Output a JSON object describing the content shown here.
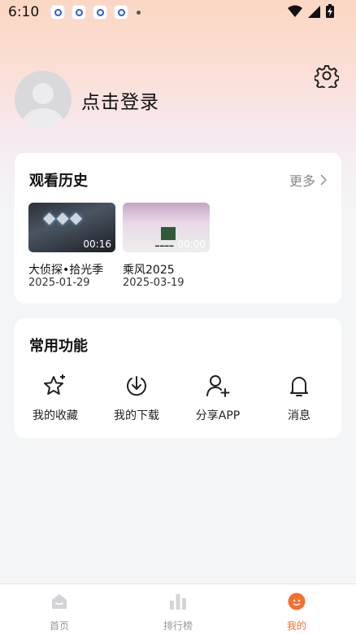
{
  "status_bar": {
    "time": "6:10"
  },
  "profile": {
    "login_text": "点击登录"
  },
  "history": {
    "title": "观看历史",
    "more_label": "更多",
    "items": [
      {
        "name": "大侦探•拾光季",
        "date": "2025-01-29",
        "duration": "00:16"
      },
      {
        "name": "乘风2025",
        "date": "2025-03-19",
        "duration": "00:00"
      }
    ]
  },
  "functions": {
    "title": "常用功能",
    "items": [
      {
        "label": "我的收藏",
        "icon": "star-icon"
      },
      {
        "label": "我的下载",
        "icon": "download-icon"
      },
      {
        "label": "分享APP",
        "icon": "share-user-icon"
      },
      {
        "label": "消息",
        "icon": "bell-icon"
      }
    ]
  },
  "bottom_nav": {
    "items": [
      {
        "label": "首页",
        "icon": "home-icon"
      },
      {
        "label": "排行榜",
        "icon": "ranking-icon"
      },
      {
        "label": "我的",
        "icon": "profile-icon",
        "active": true
      }
    ]
  },
  "colors": {
    "accent": "#f4702e",
    "background": "#f4f5f7",
    "card": "#ffffff"
  }
}
